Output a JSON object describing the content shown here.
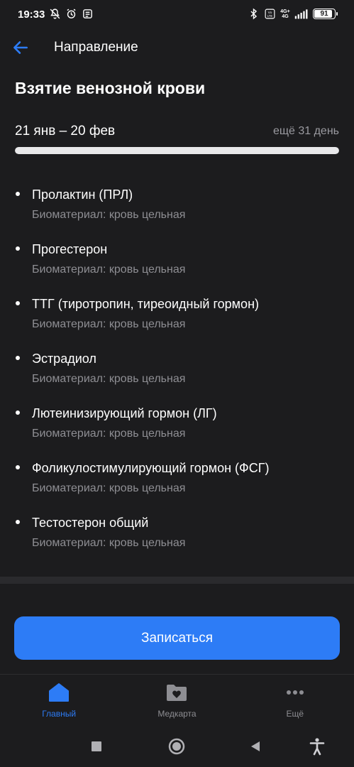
{
  "status_bar": {
    "time": "19:33",
    "network_badge_top": "4G+",
    "network_badge_bottom": "4G",
    "volte": "Vo LTE",
    "battery_level": "91",
    "icons": [
      "mute-icon",
      "alarm-icon",
      "notification-icon",
      "bluetooth-icon",
      "volte-icon",
      "signal-icon",
      "battery-icon"
    ]
  },
  "header": {
    "title": "Направление",
    "back_icon": "arrow-left-icon"
  },
  "page": {
    "title": "Взятие венозной крови",
    "date_range": "21 янв – 20 фев",
    "days_left": "ещё 31 день",
    "progress_fraction": 1.0
  },
  "tests": [
    {
      "name": "Пролактин (ПРЛ)",
      "biomaterial": "Биоматериал: кровь цельная"
    },
    {
      "name": "Прогестерон",
      "biomaterial": "Биоматериал: кровь цельная"
    },
    {
      "name": "ТТГ (тиротропин, тиреоидный гормон)",
      "biomaterial": "Биоматериал: кровь цельная"
    },
    {
      "name": "Эстрадиол",
      "biomaterial": "Биоматериал: кровь цельная"
    },
    {
      "name": "Лютеинизирующий гормон (ЛГ)",
      "biomaterial": "Биоматериал: кровь цельная"
    },
    {
      "name": "Фоликулостимулирующий гормон (ФСГ)",
      "biomaterial": "Биоматериал: кровь цельная"
    },
    {
      "name": "Тестостерон общий",
      "biomaterial": "Биоматериал: кровь цельная"
    }
  ],
  "cta": {
    "label": "Записаться"
  },
  "tabbar": {
    "tabs": [
      {
        "label": "Главный",
        "icon": "home-icon",
        "active": true
      },
      {
        "label": "Медкарта",
        "icon": "medcard-icon",
        "active": false
      },
      {
        "label": "Ещё",
        "icon": "more-icon",
        "active": false
      }
    ]
  },
  "system_nav": {
    "icons": [
      "square-icon",
      "circle-icon",
      "triangle-back-icon",
      "accessibility-icon"
    ]
  },
  "colors": {
    "background": "#1c1c1e",
    "accent": "#2d7cf6",
    "secondary_text": "#8e8e93"
  }
}
